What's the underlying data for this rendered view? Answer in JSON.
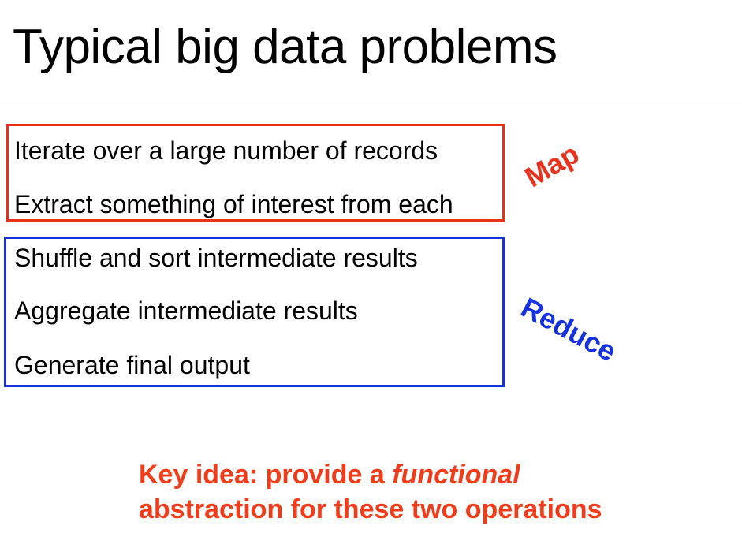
{
  "slide": {
    "title": "Typical big data problems"
  },
  "map_group": {
    "label": "Map",
    "items": [
      "Iterate over a large number of records",
      "Extract something of interest from each"
    ]
  },
  "reduce_group": {
    "label": "Reduce",
    "items": [
      "Shuffle and sort intermediate results",
      "Aggregate intermediate results",
      "Generate final output"
    ]
  },
  "key_idea": {
    "line1_prefix": "Key idea: provide a ",
    "line1_emphasis": "functional",
    "line2": "abstraction for these two operations"
  },
  "colors": {
    "map_accent": "#e8321e",
    "reduce_accent": "#1632e0",
    "key_idea_text": "#f03c1a",
    "rule": "#c8c8c8"
  }
}
